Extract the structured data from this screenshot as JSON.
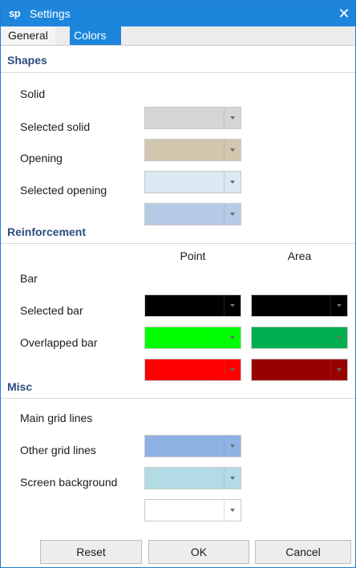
{
  "window": {
    "app_icon_text": "sp",
    "title": "Settings",
    "close_glyph": "✕"
  },
  "tabs": [
    {
      "label": "General"
    },
    {
      "label": "Colors"
    }
  ],
  "shapes": {
    "heading": "Shapes",
    "rows": [
      {
        "label": "Solid",
        "color": "#d5d5d5"
      },
      {
        "label": "Selected solid",
        "color": "#d2c8b0"
      },
      {
        "label": "Opening",
        "color": "#dbe9f2"
      },
      {
        "label": "Selected opening",
        "color": "#b5cbe6"
      }
    ]
  },
  "reinforcement": {
    "heading": "Reinforcement",
    "col_point": "Point",
    "col_area": "Area",
    "rows": [
      {
        "label": "Bar",
        "point_color": "#000000",
        "area_color": "#000000"
      },
      {
        "label": "Selected bar",
        "point_color": "#00ff00",
        "area_color": "#00b050"
      },
      {
        "label": "Overlapped bar",
        "point_color": "#ff0000",
        "area_color": "#990000"
      }
    ]
  },
  "misc": {
    "heading": "Misc",
    "rows": [
      {
        "label": "Main grid lines",
        "color": "#8eb2e3"
      },
      {
        "label": "Other grid lines",
        "color": "#b2dbe6"
      },
      {
        "label": "Screen background",
        "color": "#ffffff"
      }
    ]
  },
  "buttons": {
    "reset": "Reset",
    "ok": "OK",
    "cancel": "Cancel"
  }
}
